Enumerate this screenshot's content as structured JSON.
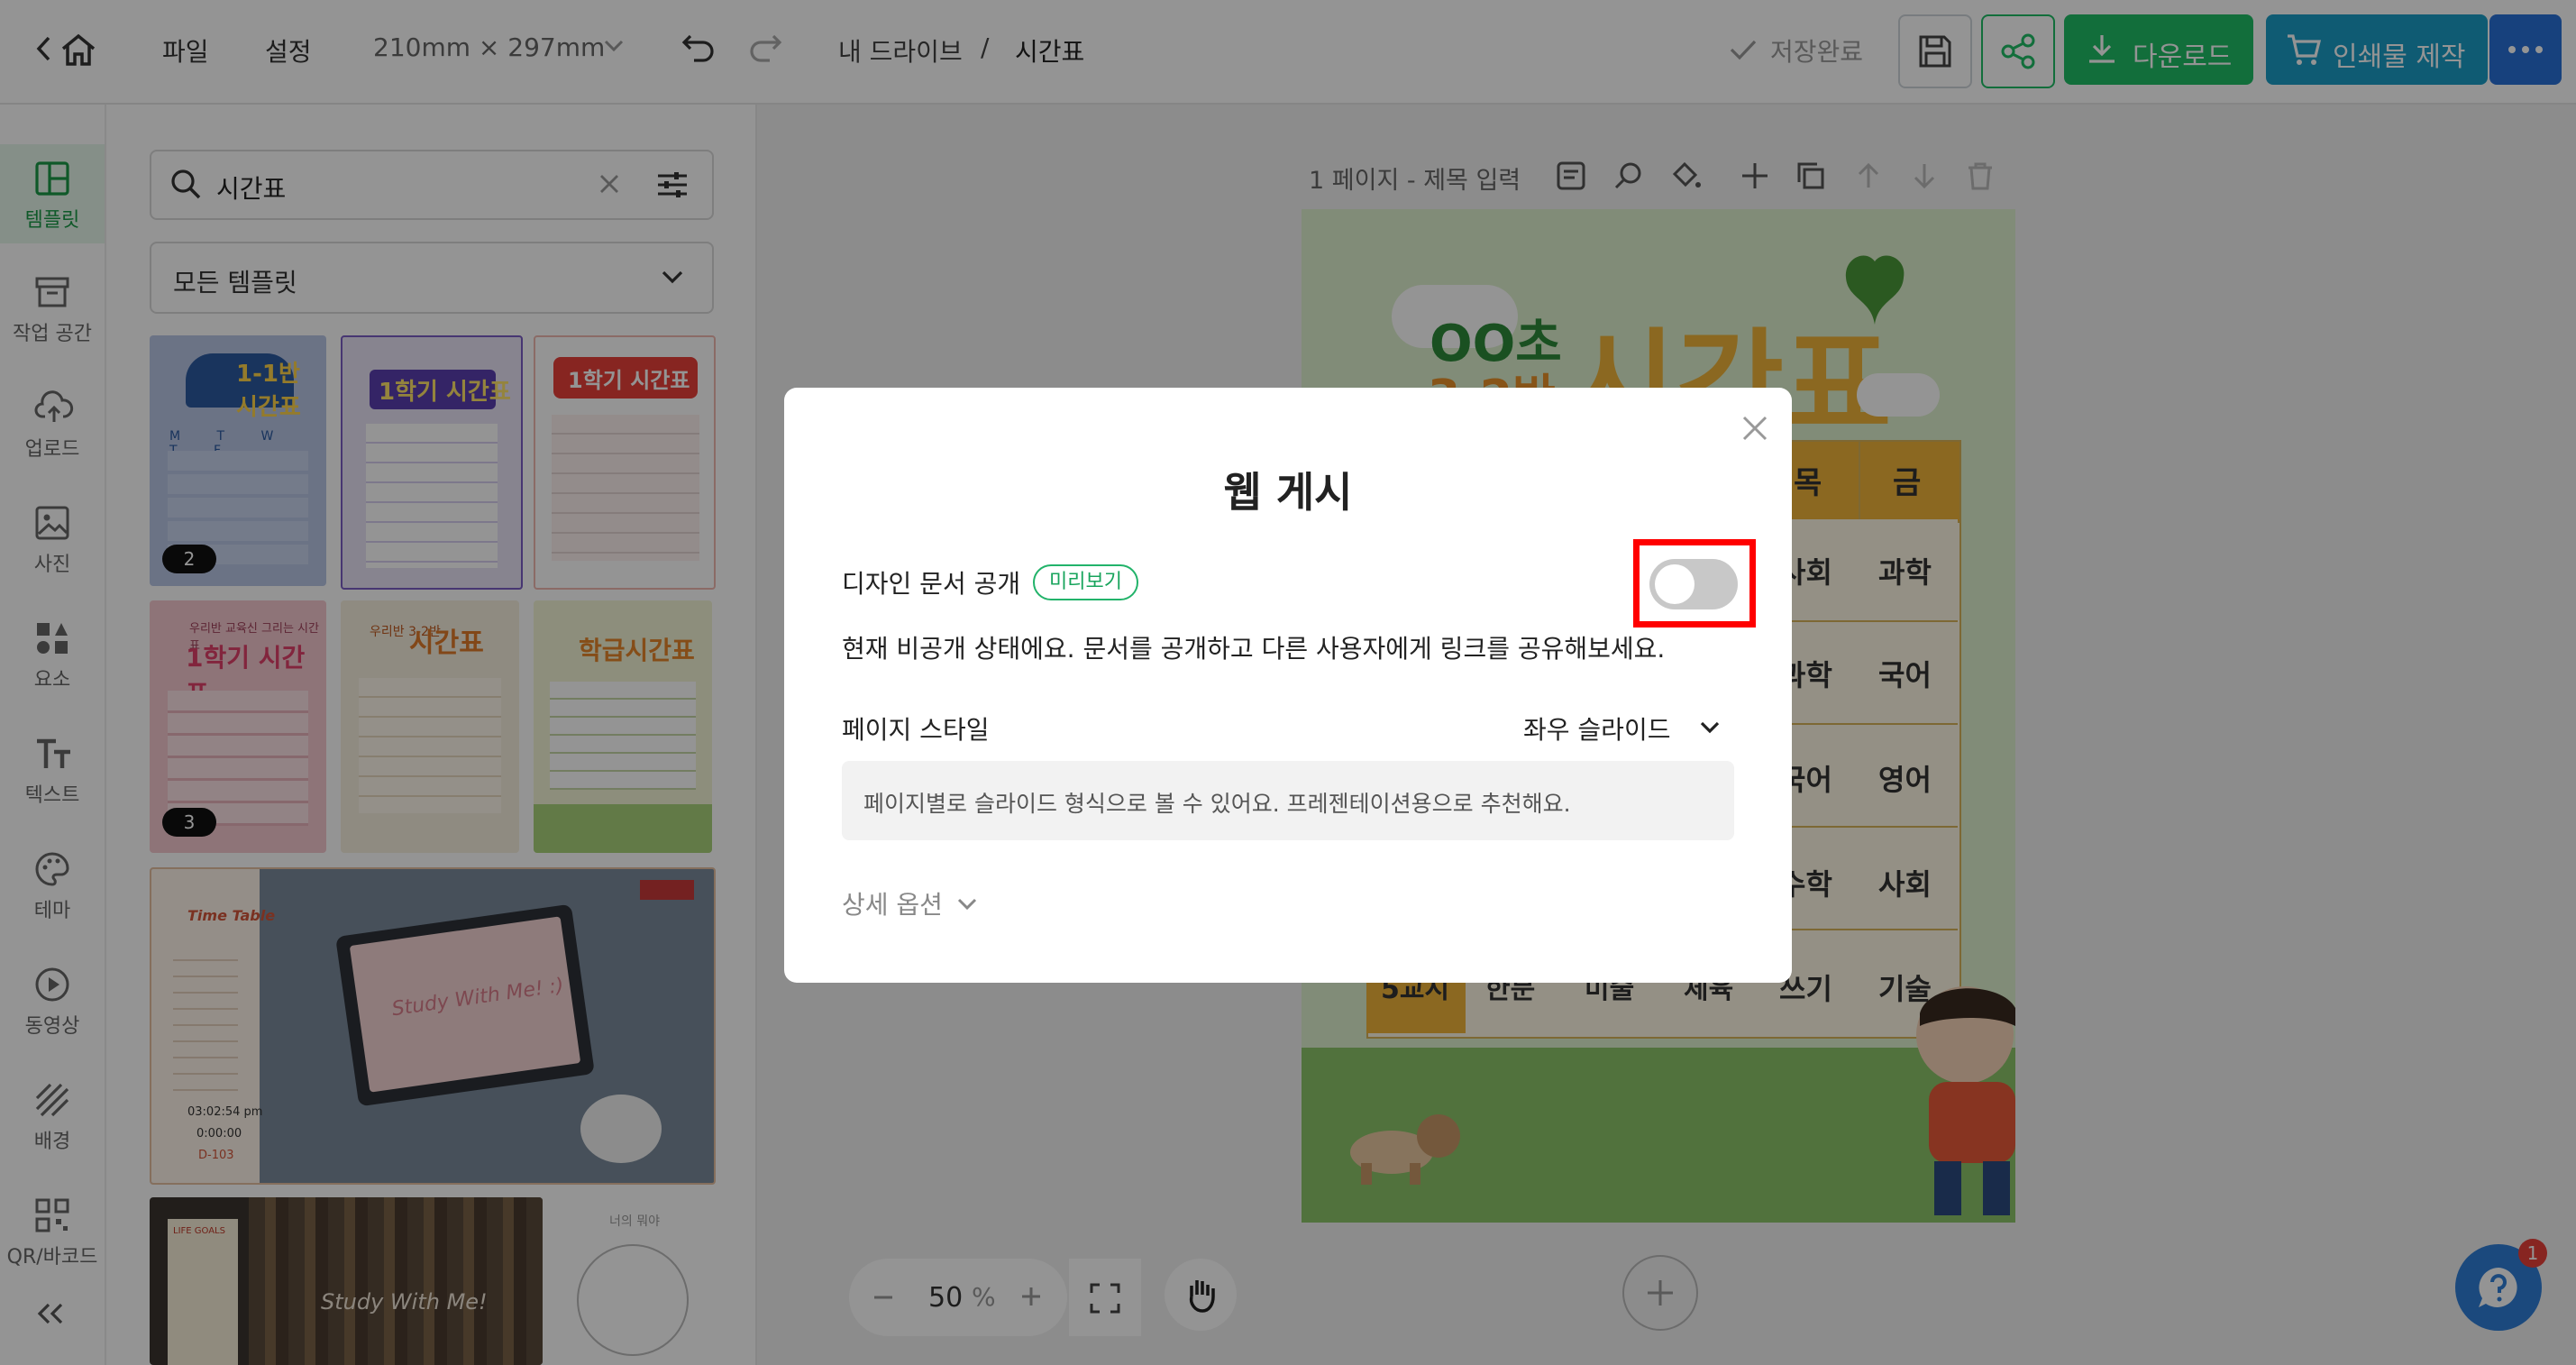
{
  "topbar": {
    "back_icon": "chevron-left-icon",
    "home_icon": "home-icon",
    "file_label": "파일",
    "settings_label": "설정",
    "page_size": "210mm × 297mm",
    "breadcrumb_root": "내 드라이브",
    "breadcrumb_sep": "/",
    "breadcrumb_current": "시간표",
    "save_status": "저장완료",
    "download_label": "다운로드",
    "print_label": "인쇄물 제작"
  },
  "rail": {
    "items": [
      {
        "label": "템플릿",
        "icon": "template-icon",
        "active": true
      },
      {
        "label": "작업 공간",
        "icon": "archive-icon"
      },
      {
        "label": "업로드",
        "icon": "upload-cloud-icon"
      },
      {
        "label": "사진",
        "icon": "photo-icon"
      },
      {
        "label": "요소",
        "icon": "elements-icon"
      },
      {
        "label": "텍스트",
        "icon": "text-icon"
      },
      {
        "label": "테마",
        "icon": "palette-icon"
      },
      {
        "label": "동영상",
        "icon": "play-icon"
      },
      {
        "label": "배경",
        "icon": "background-icon"
      },
      {
        "label": "QR/바코드",
        "icon": "qr-icon"
      }
    ],
    "collapse_icon": "double-chevron-left-icon"
  },
  "panel": {
    "search_value": "시간표",
    "filter_label": "모든 템플릿",
    "thumbnails": [
      {
        "title": "1-1반 시간표",
        "badge": "2"
      },
      {
        "title": "1학기 시간표",
        "badge": ""
      },
      {
        "title": "1학기 시간표",
        "badge": ""
      },
      {
        "title": "1학기 시간표",
        "badge": "3"
      },
      {
        "title": "시간표",
        "badge": ""
      },
      {
        "title": "학급시간표",
        "badge": ""
      },
      {
        "title": "Study With Me! :)",
        "badge": ""
      },
      {
        "title": "Study With Me!",
        "badge": ""
      },
      {
        "title": "너의 뭐야",
        "badge": ""
      }
    ],
    "thumb_texts": {
      "t1_days": "M T W T F",
      "t4_caption": "우리반 교육신 그리는 시간표",
      "t5_sub": "우리반 3-2반",
      "t7_heading": "Time Table",
      "t7_clock": "03:02:54 pm",
      "t7_timer": "0:00:00",
      "t7_dday": "D-103",
      "t8_tag": "LIFE GOALS"
    }
  },
  "canvas": {
    "page_label": "1 페이지 - 제목 입력",
    "zoom_value": "50",
    "zoom_unit": "%",
    "poster": {
      "school": "OO초",
      "class": "3-2반",
      "title": "시간표",
      "header_cells": [
        "목",
        "금"
      ],
      "rows": [
        {
          "a": "사회",
          "b": "과학"
        },
        {
          "a": "과학",
          "b": "국어"
        },
        {
          "a": "국어",
          "b": "영어"
        },
        {
          "a": "수학",
          "b": "사회"
        },
        {
          "a": "쓰기",
          "b": "기술"
        }
      ],
      "bottom_row": [
        "5교시",
        "한문",
        "미술",
        "체육"
      ]
    },
    "help_badge": "1"
  },
  "modal": {
    "title": "웹 게시",
    "public_label": "디자인 문서 공개",
    "preview_chip": "미리보기",
    "public_toggle_on": false,
    "status_text": "현재 비공개 상태에요. 문서를 공개하고 다른 사용자에게 링크를 공유해보세요.",
    "page_style_label": "페이지 스타일",
    "page_style_value": "좌우 슬라이드",
    "page_style_desc": "페이지별로 슬라이드 형식으로 볼 수 있어요. 프레젠테이션용으로 추천해요.",
    "advanced_label": "상세 옵션"
  },
  "colors": {
    "green": "#1fbd66",
    "teal": "#1a9ec7",
    "blue": "#2871d8",
    "highlight": "#ff0000"
  }
}
